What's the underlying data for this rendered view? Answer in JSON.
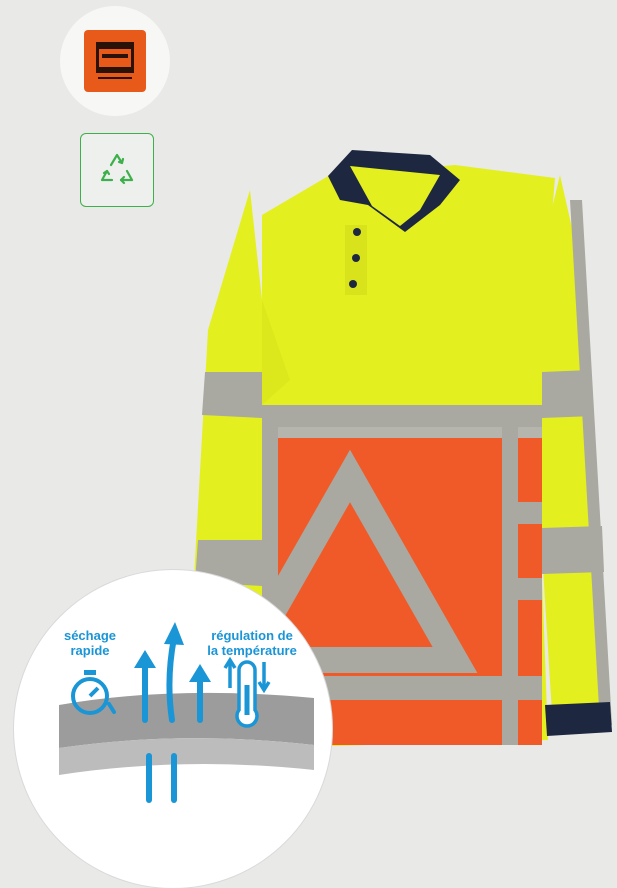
{
  "brand": {
    "logo_icon": "tricorp-safety-logo",
    "logo_color": "#e85a1a"
  },
  "recycle": {
    "icon": "recycle-icon",
    "color": "#3db04b"
  },
  "product": {
    "name": "hi-vis-polo-shirt",
    "colors": {
      "yellow": "#e4ef1f",
      "orange": "#f05a28",
      "reflective": "#a9a9a1",
      "collar": "#1e2740"
    }
  },
  "features": {
    "drying_label": "séchage\nrapide",
    "temperature_label": "régulation de\nla température",
    "accent": "#1a95d6"
  }
}
